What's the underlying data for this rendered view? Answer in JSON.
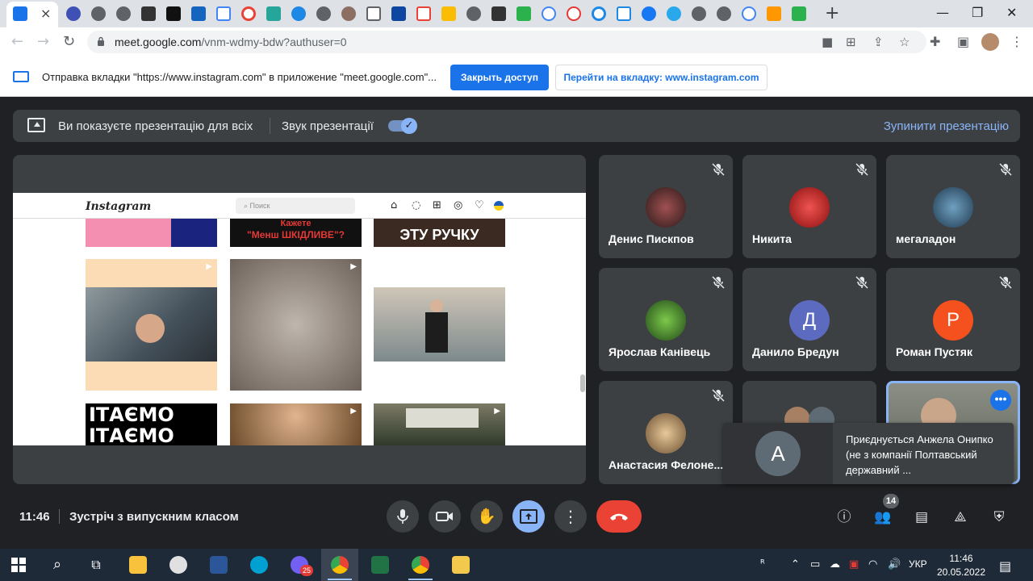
{
  "browser": {
    "tab_close": "×",
    "new_tab": "+",
    "tab_icons": [
      "calendar-icon",
      "close-icon",
      "site-icon",
      "site-icon",
      "site-icon",
      "site-icon",
      "ua-icon",
      "doc-icon",
      "record-icon",
      "shape-icon",
      "site-icon",
      "spinner-icon",
      "site-icon",
      "book-icon",
      "ai-icon",
      "gmail-icon",
      "drive-icon",
      "chrome-icon",
      "site-icon",
      "feedly-icon",
      "google-icon",
      "pin-icon",
      "target-icon",
      "screen-icon",
      "facebook-icon",
      "telegram-icon",
      "site-icon",
      "site-icon",
      "google-icon",
      "m-icon",
      "feedly-icon"
    ],
    "url_host": "meet.google.com",
    "url_path": "/vnm-wdmy-bdw?authuser=0"
  },
  "infobar": {
    "text": "Отправка вкладки \"https://www.instagram.com\" в приложение \"meet.google.com\"...",
    "stop_label": "Закрыть доступ",
    "switch_label": "Перейти на вкладку: www.instagram.com"
  },
  "presenting_bar": {
    "text": "Ви показуєте презентацію для всіх",
    "sound_label": "Звук презентації",
    "sound_on": true,
    "stop_label": "Зупинити презентацію"
  },
  "instagram": {
    "logo": "Instagram",
    "search_placeholder": "Поиск",
    "tile_texts": [
      "Кажете",
      "\"Менш ШКІДЛИВЕ\"?",
      "ЭТУ РУЧКУ",
      "ІТАЄМО",
      "ІТАЄМО"
    ]
  },
  "participants": [
    {
      "name": "Денис Пискпов",
      "muted": true,
      "avatar": "photo",
      "color": "#6b2f2f"
    },
    {
      "name": "Никита",
      "muted": true,
      "avatar": "photo",
      "color": "#c62828"
    },
    {
      "name": "мегаладон",
      "muted": true,
      "avatar": "photo",
      "color": "#3a6b8a"
    },
    {
      "name": "Ярослав Канівець",
      "muted": true,
      "avatar": "photo",
      "color": "#3d7a2a"
    },
    {
      "name": "Данило Бредун",
      "muted": true,
      "avatar": "Д",
      "color": "#5c6bc0"
    },
    {
      "name": "Роман Пустяк",
      "muted": true,
      "avatar": "Р",
      "color": "#f4511e"
    },
    {
      "name": "Анастасия Фелоне...",
      "muted": true,
      "avatar": "photo",
      "color": "#b08a55"
    }
  ],
  "self_tile": {
    "more_label": "•••"
  },
  "toast": {
    "avatar_letter": "А",
    "text": "Приєднується Анжела Онипко (не з компанії Полтавський державний ..."
  },
  "controls": {
    "time": "11:46",
    "meeting_name": "Зустріч з випускним класом",
    "participants_count": "14"
  },
  "taskbar": {
    "lang": "УКР",
    "time": "11:46",
    "date": "20.05.2022",
    "viber_badge": "25"
  }
}
